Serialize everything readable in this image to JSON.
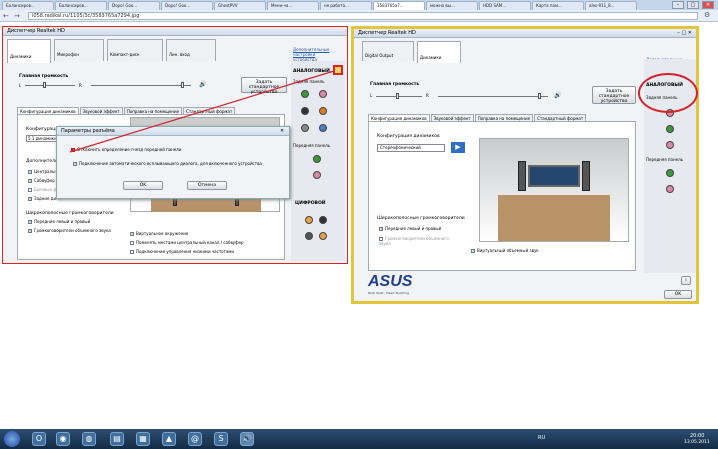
{
  "browser": {
    "tabs": [
      "Балансиров...",
      "Балансиров...",
      "Dopo! Goo...",
      "Dopo! Goo...",
      "GhostPVV",
      "Мени-ча...",
      "не работа...",
      "3583765a7...",
      "можно вы...",
      "HDD SAM...",
      "Карта пам...",
      "ales-911_8..."
    ],
    "active_tab_index": 7,
    "url": "i058.radikal.ru/1105/3c/3583765a7294.jpg",
    "window_controls": [
      "–",
      "□",
      "✕"
    ]
  },
  "left_dialog": {
    "title": "Диспетчер Realtek HD",
    "device_tabs": [
      "Динамики",
      "Микрофон",
      "Компакт-диск",
      "Лин. вход"
    ],
    "link": "Дополнительные настройки устройства",
    "volume_label": "Главная громкость",
    "l": "L",
    "r": "R",
    "set_default": "Задать стандартное устройство",
    "tabs": [
      "Конфигурация динамиков",
      "Звуковой эффект",
      "Поправка на помещение",
      "Стандартный формат"
    ],
    "config_label": "Конфигурация",
    "config_value": "5.1 динамики",
    "extra_label": "Дополнительные",
    "options_left": [
      "Центральн...",
      "Сабвуфер",
      "Боковые д...",
      "Задние ди..."
    ],
    "wide_label": "Широкополосные громкоговорители",
    "wide_options": [
      "Передние левый и правый",
      "Громкоговорители объемного звука"
    ],
    "bottom_options": [
      "Виртуальное окружение",
      "Поменять местами центральный канал / сабвуфер",
      "Подключение управления низкими частотами"
    ],
    "analog": "АНАЛОГОВЫЙ",
    "back_panel": "Задняя панель",
    "front_panel": "Передняя панель",
    "digital": "ЦИФРОВОЙ"
  },
  "popup": {
    "title": "Параметры разъёма",
    "option1": "Отключить определение гнезд передней панели",
    "option2": "Подключение автоматического всплывающего диалога, для включенного устройства",
    "ok": "OK",
    "cancel": "Отмена"
  },
  "right_dialog": {
    "title": "Диспетчер Realtek HD",
    "device_tabs": [
      "Digital Output",
      "Динамики"
    ],
    "link": "Дополнительные настройки устройства",
    "volume_label": "Главная громкость",
    "l": "L",
    "r": "R",
    "set_default": "Задать стандартное устройство",
    "tabs": [
      "Конфигурация динамиков",
      "Звуковой эффект",
      "Поправка на помещение",
      "Стандартный формат"
    ],
    "config_label": "Конфигурация динамиков",
    "config_value": "Стереофонический",
    "wide_label": "Широкополосные громкоговорители",
    "wide_options": [
      "Передние левый и правый",
      "Громкоговорители объемного звука"
    ],
    "virtual": "Виртуальный объемный звук",
    "analog": "АНАЛОГОВЫЙ",
    "back_panel": "Задняя панель",
    "front_panel": "Передняя панель",
    "brand": "ASUS",
    "brand_tagline": "Rock Solid · Heart Touching",
    "ok": "OK",
    "info": "i"
  },
  "taskbar": {
    "lang": "RU",
    "time": "20:00",
    "date": "13.05.2011"
  },
  "colors": {
    "highlight_red": "#d2232a",
    "yellow_frame": "#e3c53a",
    "pink_jack": "#d98aa6",
    "green_jack": "#3a9a3a"
  }
}
